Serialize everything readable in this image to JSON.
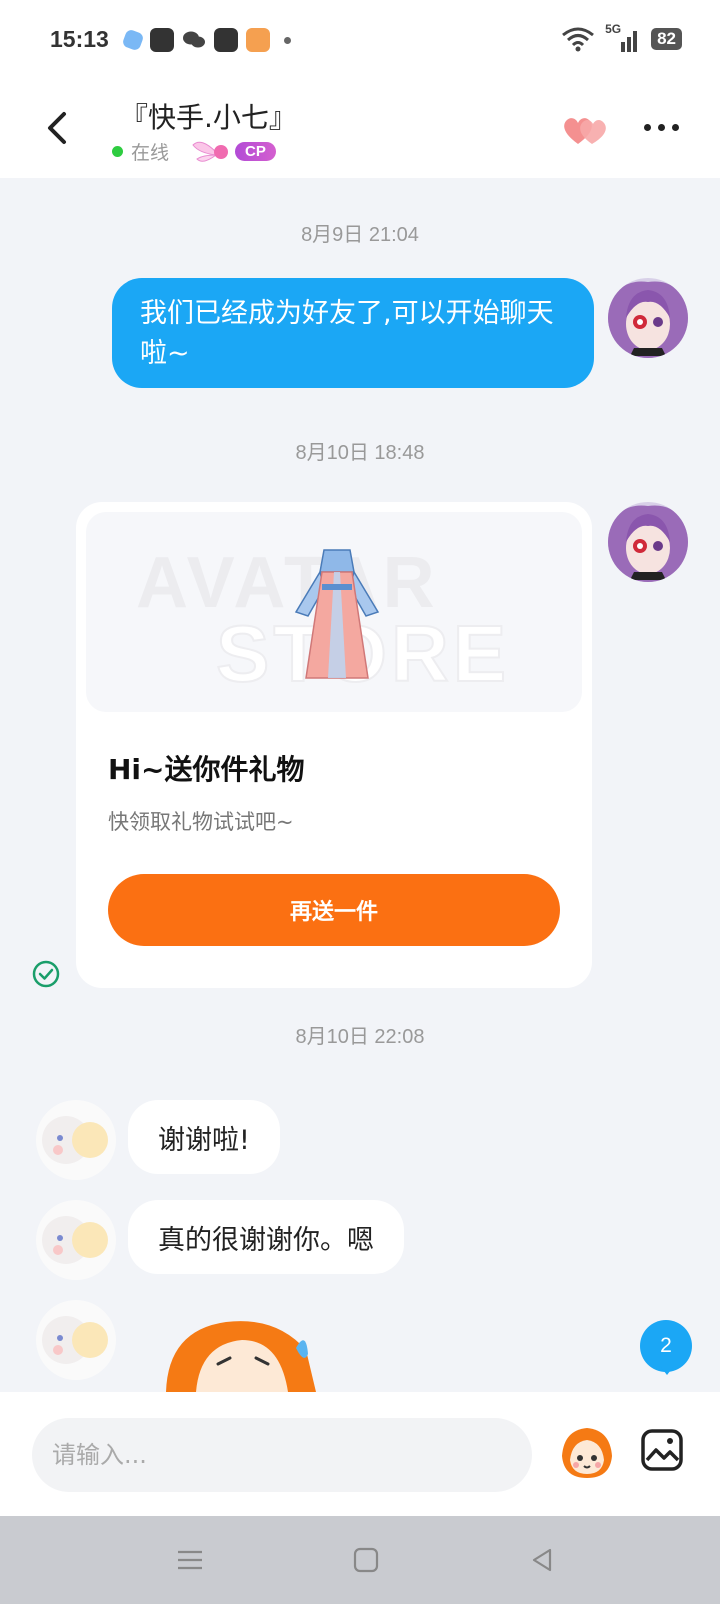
{
  "status_bar": {
    "time": "15:13",
    "network": "5G",
    "battery": "82"
  },
  "header": {
    "title": "『快手.小七』",
    "status": "在线",
    "badge": "CP"
  },
  "messages": {
    "ts1": "8月9日 21:04",
    "msg1": "我们已经成为好友了,可以开始聊天啦~",
    "ts2": "8月10日 18:48",
    "gift_card": {
      "watermark_top": "AVATAR",
      "watermark_bottom": "STORE",
      "title": "Hi~送你件礼物",
      "subtitle": "快领取礼物试试吧~",
      "button": "再送一件"
    },
    "ts3": "8月10日 22:08",
    "reply1": "谢谢啦!",
    "reply2": "真的很谢谢你。嗯",
    "unread_count": "2"
  },
  "input": {
    "placeholder": "请输入..."
  },
  "colors": {
    "accent_blue": "#1ba7f5",
    "accent_orange": "#fb7012",
    "online_green": "#2ecc40"
  }
}
